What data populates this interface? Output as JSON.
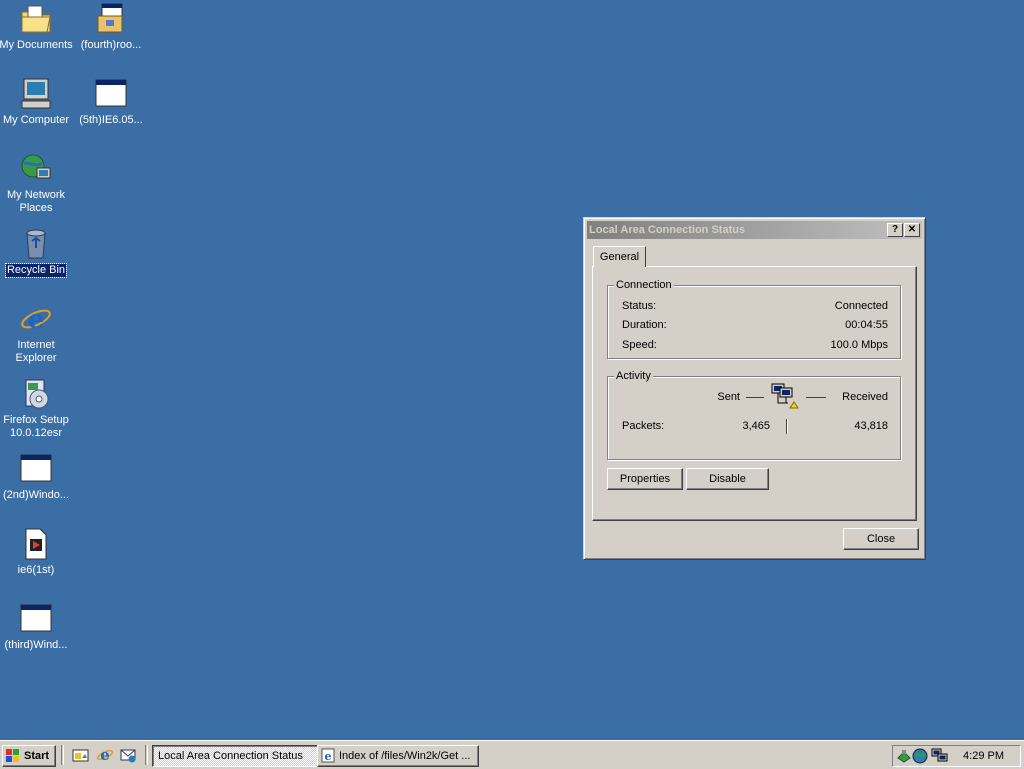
{
  "desktop": {
    "icons": [
      {
        "label": "My Documents",
        "icon": "folder-documents-icon"
      },
      {
        "label": "(fourth)roo...",
        "icon": "installer-icon"
      },
      {
        "label": "My Computer",
        "icon": "computer-icon"
      },
      {
        "label": "(5th)IE6.05...",
        "icon": "window-icon"
      },
      {
        "label": "My Network Places",
        "icon": "network-places-icon"
      },
      {
        "label": "Recycle Bin",
        "icon": "recycle-bin-icon"
      },
      {
        "label": "Internet Explorer",
        "icon": "internet-explorer-icon"
      },
      {
        "label": "Firefox Setup 10.0.12esr",
        "icon": "setup-icon"
      },
      {
        "label": "(2nd)Windo...",
        "icon": "window-icon"
      },
      {
        "label": "ie6(1st)",
        "icon": "media-file-icon"
      },
      {
        "label": "(third)Wind...",
        "icon": "window-icon"
      }
    ]
  },
  "dialog": {
    "title": "Local Area Connection Status",
    "help": "?",
    "close_x": "✕",
    "tab": "General",
    "connection": {
      "title": "Connection",
      "status_label": "Status:",
      "status_value": "Connected",
      "duration_label": "Duration:",
      "duration_value": "00:04:55",
      "speed_label": "Speed:",
      "speed_value": "100.0 Mbps"
    },
    "activity": {
      "title": "Activity",
      "sent_label": "Sent",
      "received_label": "Received",
      "packets_label": "Packets:",
      "packets_sent": "3,465",
      "packets_received": "43,818"
    },
    "properties_button": "Properties",
    "disable_button": "Disable",
    "close_button": "Close"
  },
  "taskbar": {
    "start_label": "Start",
    "tasks": [
      {
        "label": "Local Area Connection Status",
        "active": true
      },
      {
        "label": "Index of /files/Win2k/Get ...",
        "active": false
      }
    ],
    "clock": "4:29 PM"
  },
  "colors": {
    "desktop_bg": "#3a6ea5",
    "face": "#d4d0c8",
    "selection": "#0a246a"
  }
}
